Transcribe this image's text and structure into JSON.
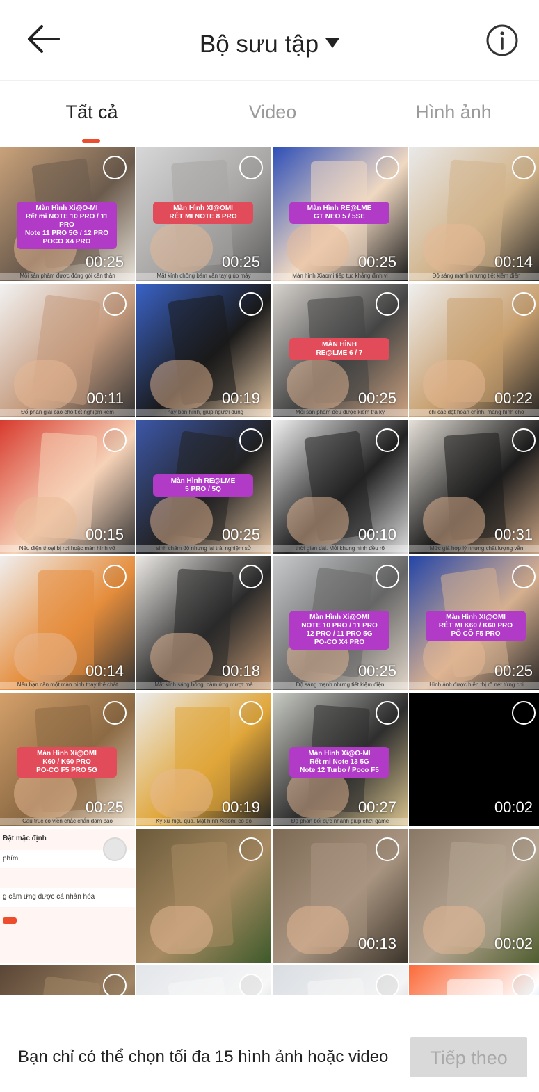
{
  "header": {
    "title": "Bộ sưu tập",
    "back_icon": "arrow-left-icon",
    "info_icon": "info-circle-icon",
    "dropdown_icon": "caret-down-icon"
  },
  "tabs": [
    {
      "label": "Tất cả",
      "active": true
    },
    {
      "label": "Video",
      "active": false
    },
    {
      "label": "Hình ảnh",
      "active": false
    }
  ],
  "colors": {
    "accent": "#ee4d2d",
    "disabled_button_bg": "#d9d9d9",
    "disabled_button_text": "#a9a9a9"
  },
  "media": [
    {
      "duration": "00:25",
      "label": "Màn Hình Xi@O-MI\nRết mi NOTE 10 PRO / 11 PRO\nNote 11 PRO 5G / 12 PRO\nPOCO X4 PRO",
      "caption": "Mỗi sản phẩm được đóng gói cẩn thận"
    },
    {
      "duration": "00:25",
      "label": "Màn Hình XI@OMI\nRÉT MI NOTE 8 PRO",
      "caption": "Mặt kính chống bám vân tay giúp máy"
    },
    {
      "duration": "00:25",
      "label": "Màn Hình RE@LME\nGT NEO 5 / 5SE",
      "caption": "Màn hình Xiaomi tiếp tục khẳng định vị"
    },
    {
      "duration": "00:14",
      "label": "",
      "caption": "Độ sáng mạnh nhưng tiết kiệm điện"
    },
    {
      "duration": "00:11",
      "label": "",
      "caption": "Đổ phân giải cao cho tiết nghiệm xem"
    },
    {
      "duration": "00:19",
      "label": "",
      "caption": "Thay bản hình, giúp người dùng"
    },
    {
      "duration": "00:25",
      "label": "MÀN HÌNH\nRE@LME 6 / 7",
      "caption": "Mỗi sản phẩm đều được kiểm tra kỹ"
    },
    {
      "duration": "00:22",
      "label": "",
      "caption": "chi các đặt hoàn chỉnh, màng hình cho"
    },
    {
      "duration": "00:15",
      "label": "",
      "caption": "Nếu điện thoại bị rơi hoặc màn hình vỡ"
    },
    {
      "duration": "00:25",
      "label": "Màn Hình RE@LME\n5 PRO / 5Q",
      "caption": "sinh chăm độ nhưng lại trải nghiệm sử"
    },
    {
      "duration": "00:10",
      "label": "",
      "caption": "thời gian dài. Mỗi khung hình đều rõ"
    },
    {
      "duration": "00:31",
      "label": "",
      "caption": "Mức giá hợp lý nhưng chất lượng vẫn"
    },
    {
      "duration": "00:14",
      "label": "",
      "caption": "Nếu bạn cần một màn hình thay thế chất"
    },
    {
      "duration": "00:18",
      "label": "",
      "caption": "Mặt kính sáng bóng, cảm ứng mượt mà"
    },
    {
      "duration": "00:25",
      "label": "Màn Hình Xi@OMI\nNOTE 10 PRO / 11 PRO\n12 PRO / 11 PRO 5G\nPO-CO X4 PRO",
      "caption": "Độ sáng mạnh nhưng tiết kiệm điện"
    },
    {
      "duration": "00:25",
      "label": "Màn Hình XI@OMI\nRÉT MI K60 / K60 PRO\nPÔ CÔ F5 PRO",
      "caption": "Hình ảnh được hiển thị rõ nét từng chi"
    },
    {
      "duration": "00:25",
      "label": "Màn Hình Xi@OMI\nK60 / K60 PRO\nPO-CO F5 PRO 5G",
      "caption": "Cấu trúc có viền chắc chắn đảm bảo"
    },
    {
      "duration": "00:19",
      "label": "",
      "caption": "Kỹ xứ hiệu quả. Mặt hình Xiaomi có độ"
    },
    {
      "duration": "00:27",
      "label": "Màn Hình Xi@O-MI\nRết mi Note 13 5G\nNote 12 Turbo / Poco F5",
      "caption": "Độ phân bối cực nhanh giúp chơi game"
    },
    {
      "duration": "00:02",
      "label": "",
      "caption": ""
    },
    {
      "duration": "",
      "label": "",
      "caption": ""
    },
    {
      "duration": "",
      "label": "",
      "caption": ""
    },
    {
      "duration": "00:13",
      "label": "",
      "caption": ""
    },
    {
      "duration": "00:02",
      "label": "",
      "caption": ""
    },
    {
      "duration": "",
      "label": "",
      "caption": ""
    },
    {
      "duration": "",
      "label": "",
      "caption": ""
    },
    {
      "duration": "",
      "label": "",
      "caption": ""
    },
    {
      "duration": "",
      "label": "",
      "caption": ""
    }
  ],
  "settings_thumb": {
    "title": "Đặt mặc định",
    "row1": "phím",
    "row2": "g cảm ứng được cá nhân hóa"
  },
  "footer": {
    "message": "Bạn chỉ có thể chọn tối đa 15 hình ảnh hoặc video",
    "next_label": "Tiếp theo"
  }
}
